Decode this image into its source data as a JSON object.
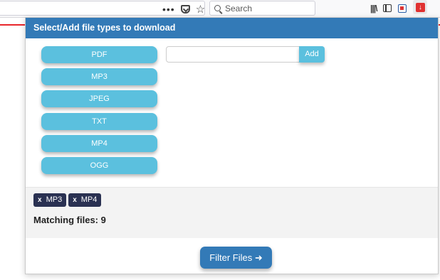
{
  "browser": {
    "search_placeholder": "Search",
    "menu_dots": "•••"
  },
  "popup": {
    "title": "Select/Add file types to download",
    "file_types": [
      "PDF",
      "MP3",
      "JPEG",
      "TXT",
      "MP4",
      "OGG"
    ],
    "custom_type_value": "",
    "add_label": "Add",
    "selected_tags": [
      "MP3",
      "MP4"
    ],
    "tag_remove_glyph": "x",
    "matching_label": "Matching files:",
    "matching_count": "9",
    "filter_button_label": "Filter Files ➜"
  },
  "colors": {
    "header": "#337ab7",
    "type_button": "#5bc0de",
    "tag": "#2a3152",
    "accent_red": "#e8262b"
  }
}
